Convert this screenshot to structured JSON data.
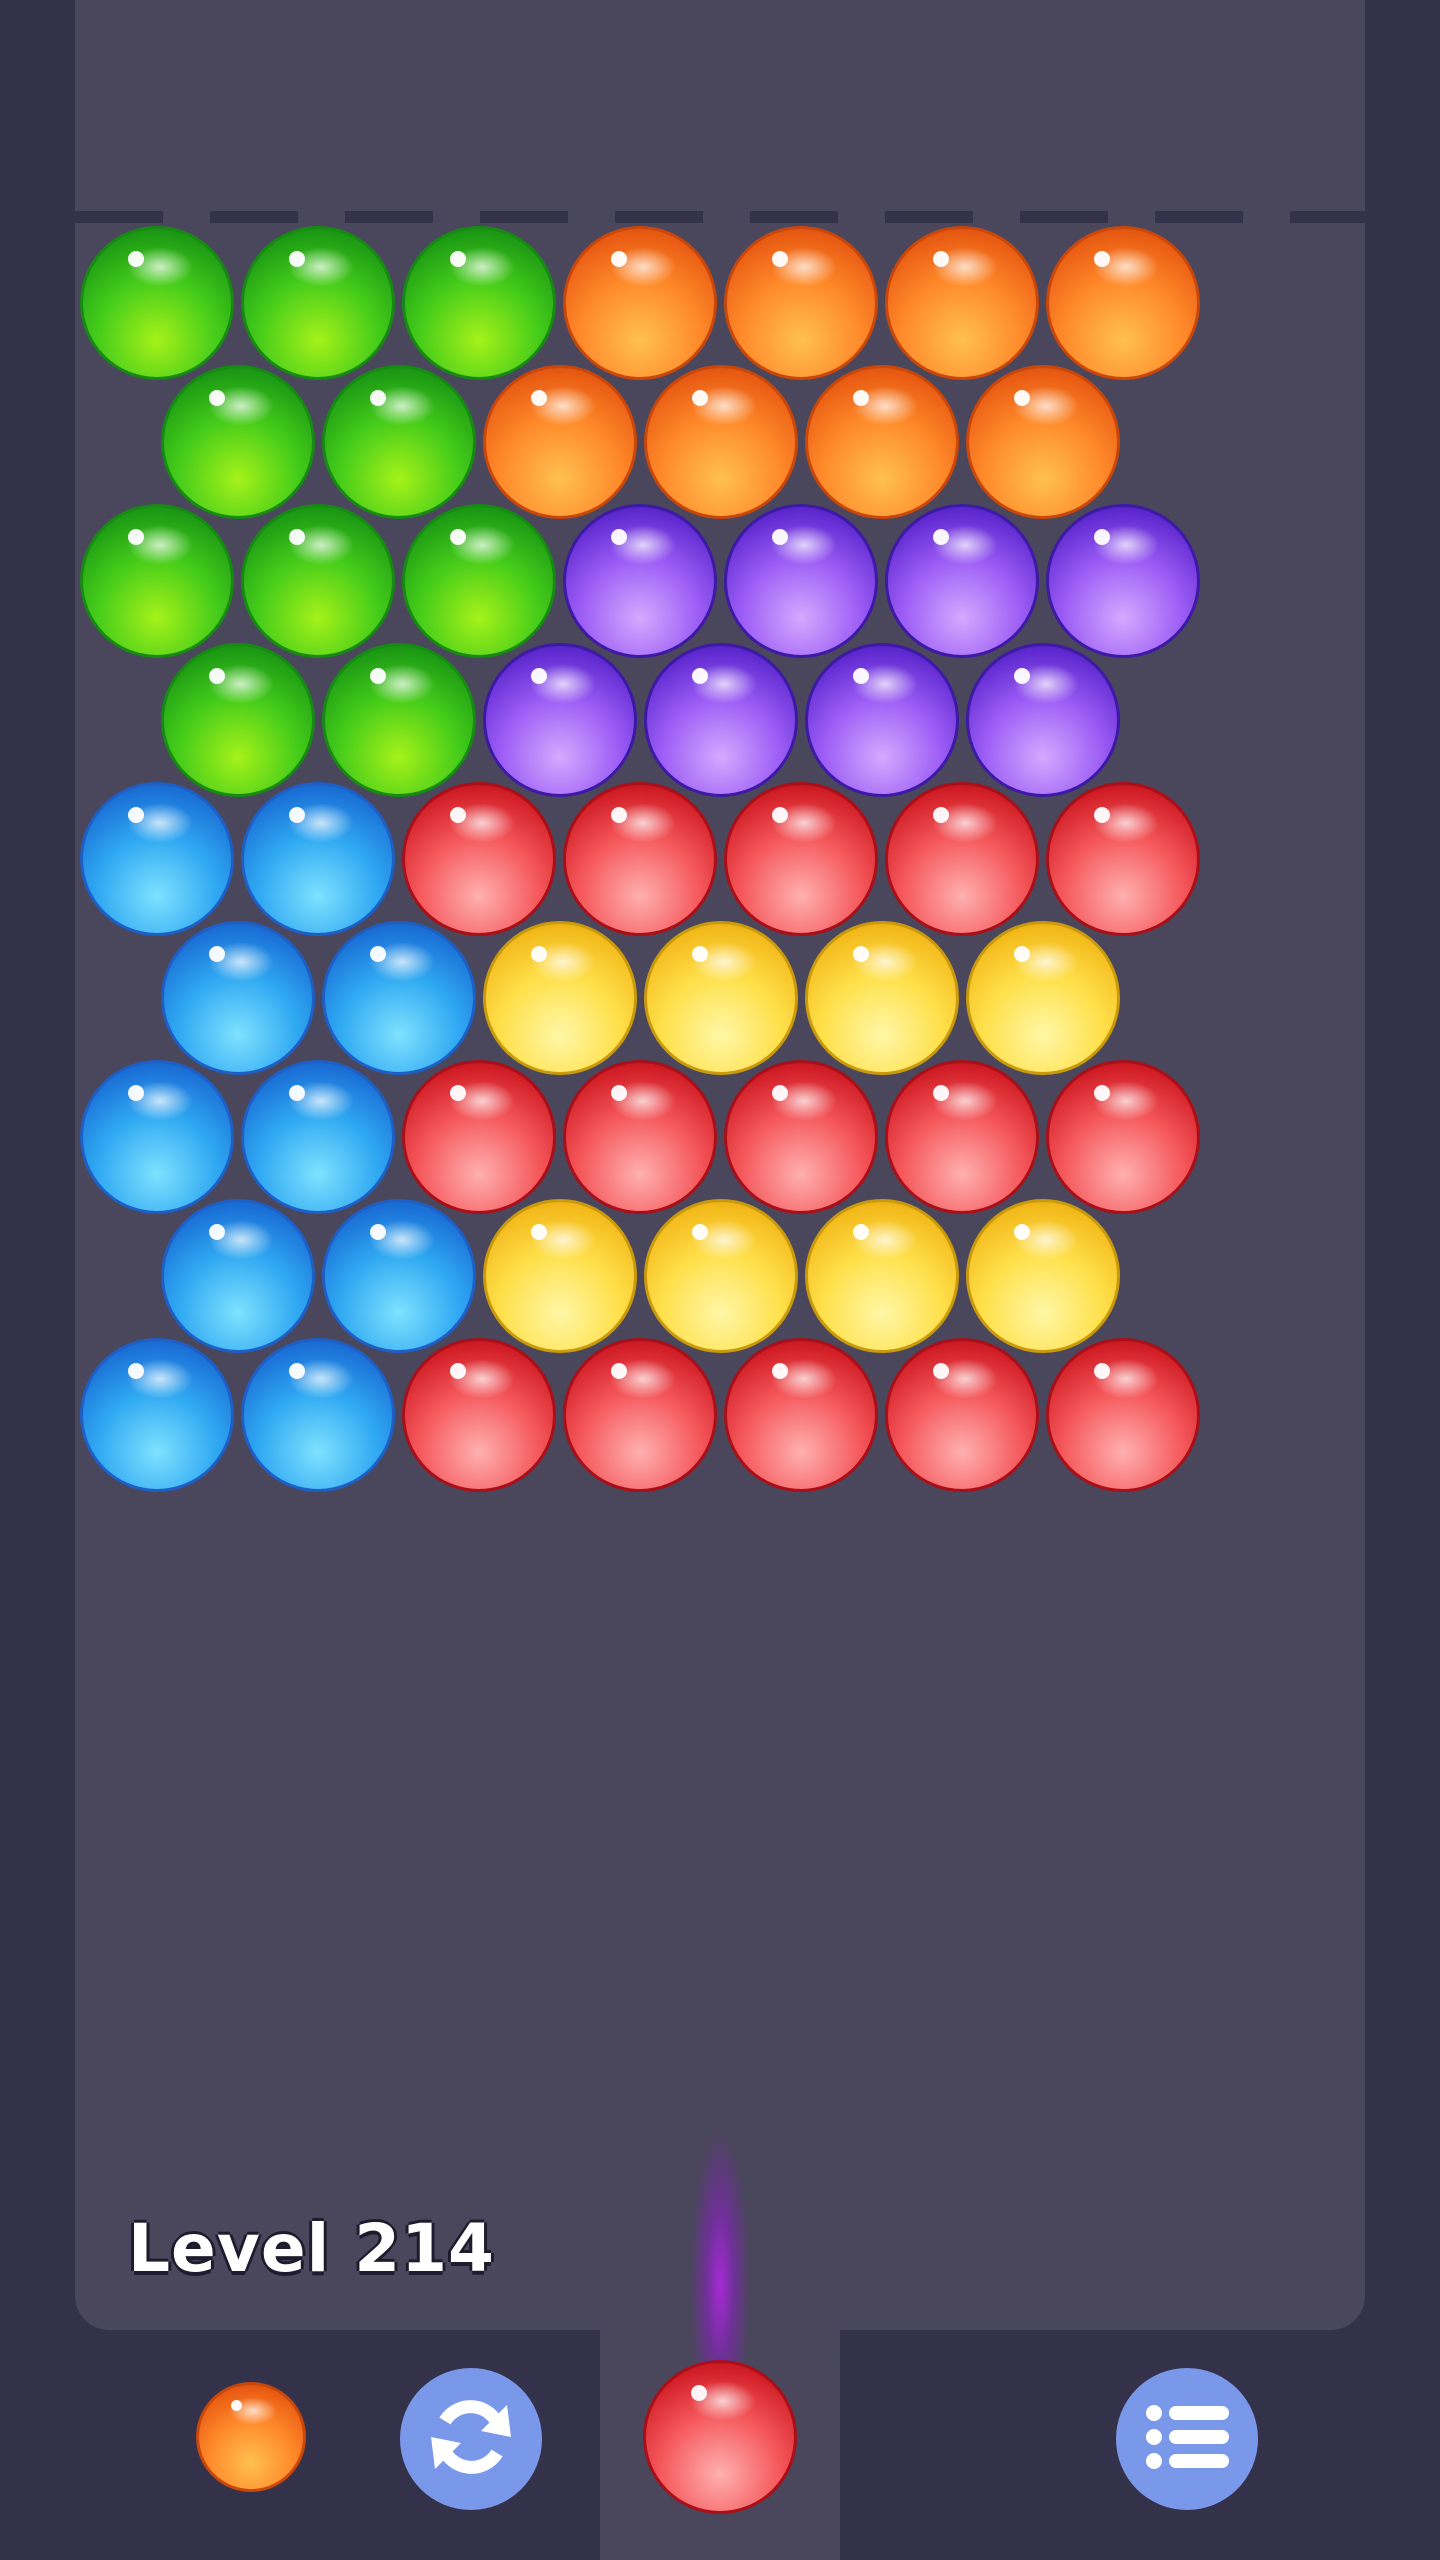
{
  "game": {
    "level_label": "Level 214"
  },
  "colors": {
    "green": "#45cc1a",
    "orange": "#ff8a2a",
    "purple": "#9b5cf5",
    "blue": "#2fa8f2",
    "red": "#f5585b",
    "yellow": "#ffe04a",
    "board": "#4a465c",
    "frame": "#34324a",
    "button": "#7a98ea",
    "aim_glow": "#a028dc"
  },
  "grid": {
    "rows": [
      [
        "green",
        "green",
        "green",
        "orange",
        "orange",
        "orange",
        "orange"
      ],
      [
        "green",
        "green",
        "orange",
        "orange",
        "orange",
        "orange"
      ],
      [
        "green",
        "green",
        "green",
        "purple",
        "purple",
        "purple",
        "purple"
      ],
      [
        "green",
        "green",
        "purple",
        "purple",
        "purple",
        "purple"
      ],
      [
        "blue",
        "blue",
        "red",
        "red",
        "red",
        "red",
        "red"
      ],
      [
        "blue",
        "blue",
        "yellow",
        "yellow",
        "yellow",
        "yellow"
      ],
      [
        "blue",
        "blue",
        "red",
        "red",
        "red",
        "red",
        "red"
      ],
      [
        "blue",
        "blue",
        "yellow",
        "yellow",
        "yellow",
        "yellow"
      ],
      [
        "blue",
        "blue",
        "red",
        "red",
        "red",
        "red",
        "red"
      ]
    ]
  },
  "shooter": {
    "current_color": "red",
    "next_color": "orange"
  },
  "controls": {
    "swap_icon": "swap-arrows-icon",
    "menu_icon": "list-menu-icon"
  }
}
